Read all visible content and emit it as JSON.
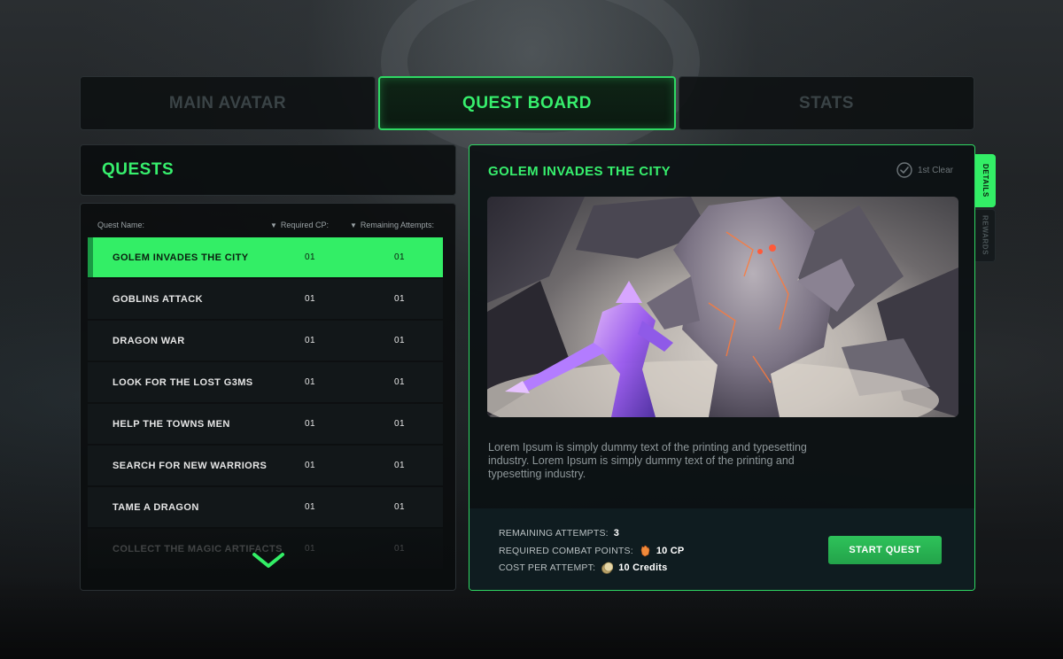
{
  "tabs": [
    {
      "label": "MAIN AVATAR",
      "active": false
    },
    {
      "label": "QUEST BOARD",
      "active": true
    },
    {
      "label": "STATS",
      "active": false
    }
  ],
  "quests_panel": {
    "title": "QUESTS",
    "columns": {
      "name": "Quest Name:",
      "required_cp": "Required CP:",
      "remaining_attempts": "Remaining Attempts:"
    },
    "rows": [
      {
        "name": "GOLEM INVADES THE CITY",
        "cp": "01",
        "attempts": "01",
        "selected": true
      },
      {
        "name": "GOBLINS ATTACK",
        "cp": "01",
        "attempts": "01"
      },
      {
        "name": "DRAGON WAR",
        "cp": "01",
        "attempts": "01"
      },
      {
        "name": "LOOK FOR THE LOST G3MS",
        "cp": "01",
        "attempts": "01"
      },
      {
        "name": "HELP THE TOWNS MEN",
        "cp": "01",
        "attempts": "01"
      },
      {
        "name": "SEARCH FOR NEW WARRIORS",
        "cp": "01",
        "attempts": "01"
      },
      {
        "name": "TAME A DRAGON",
        "cp": "01",
        "attempts": "01"
      },
      {
        "name": "COLLECT THE MAGIC ARTIFACTS",
        "cp": "01",
        "attempts": "01"
      }
    ]
  },
  "detail": {
    "title": "GOLEM INVADES THE CITY",
    "first_clear": "1st Clear",
    "description": "Lorem Ipsum is simply dummy text of the printing and typesetting industry. Lorem Ipsum is simply dummy text of the printing and typesetting industry.",
    "remaining_attempts_label": "REMAINING ATTEMPTS:",
    "remaining_attempts_value": "3",
    "required_cp_label": "REQUIRED COMBAT POINTS:",
    "required_cp_value": "10 CP",
    "cost_label": "COST PER ATTEMPT:",
    "cost_value": "10 Credits",
    "start_button": "START QUEST"
  },
  "side_tabs": {
    "details": "DETAILS",
    "rewards": "REWARDS"
  },
  "colors": {
    "accent": "#33ee66",
    "accent_dark": "#23a34a",
    "panel": "#0c1113"
  }
}
